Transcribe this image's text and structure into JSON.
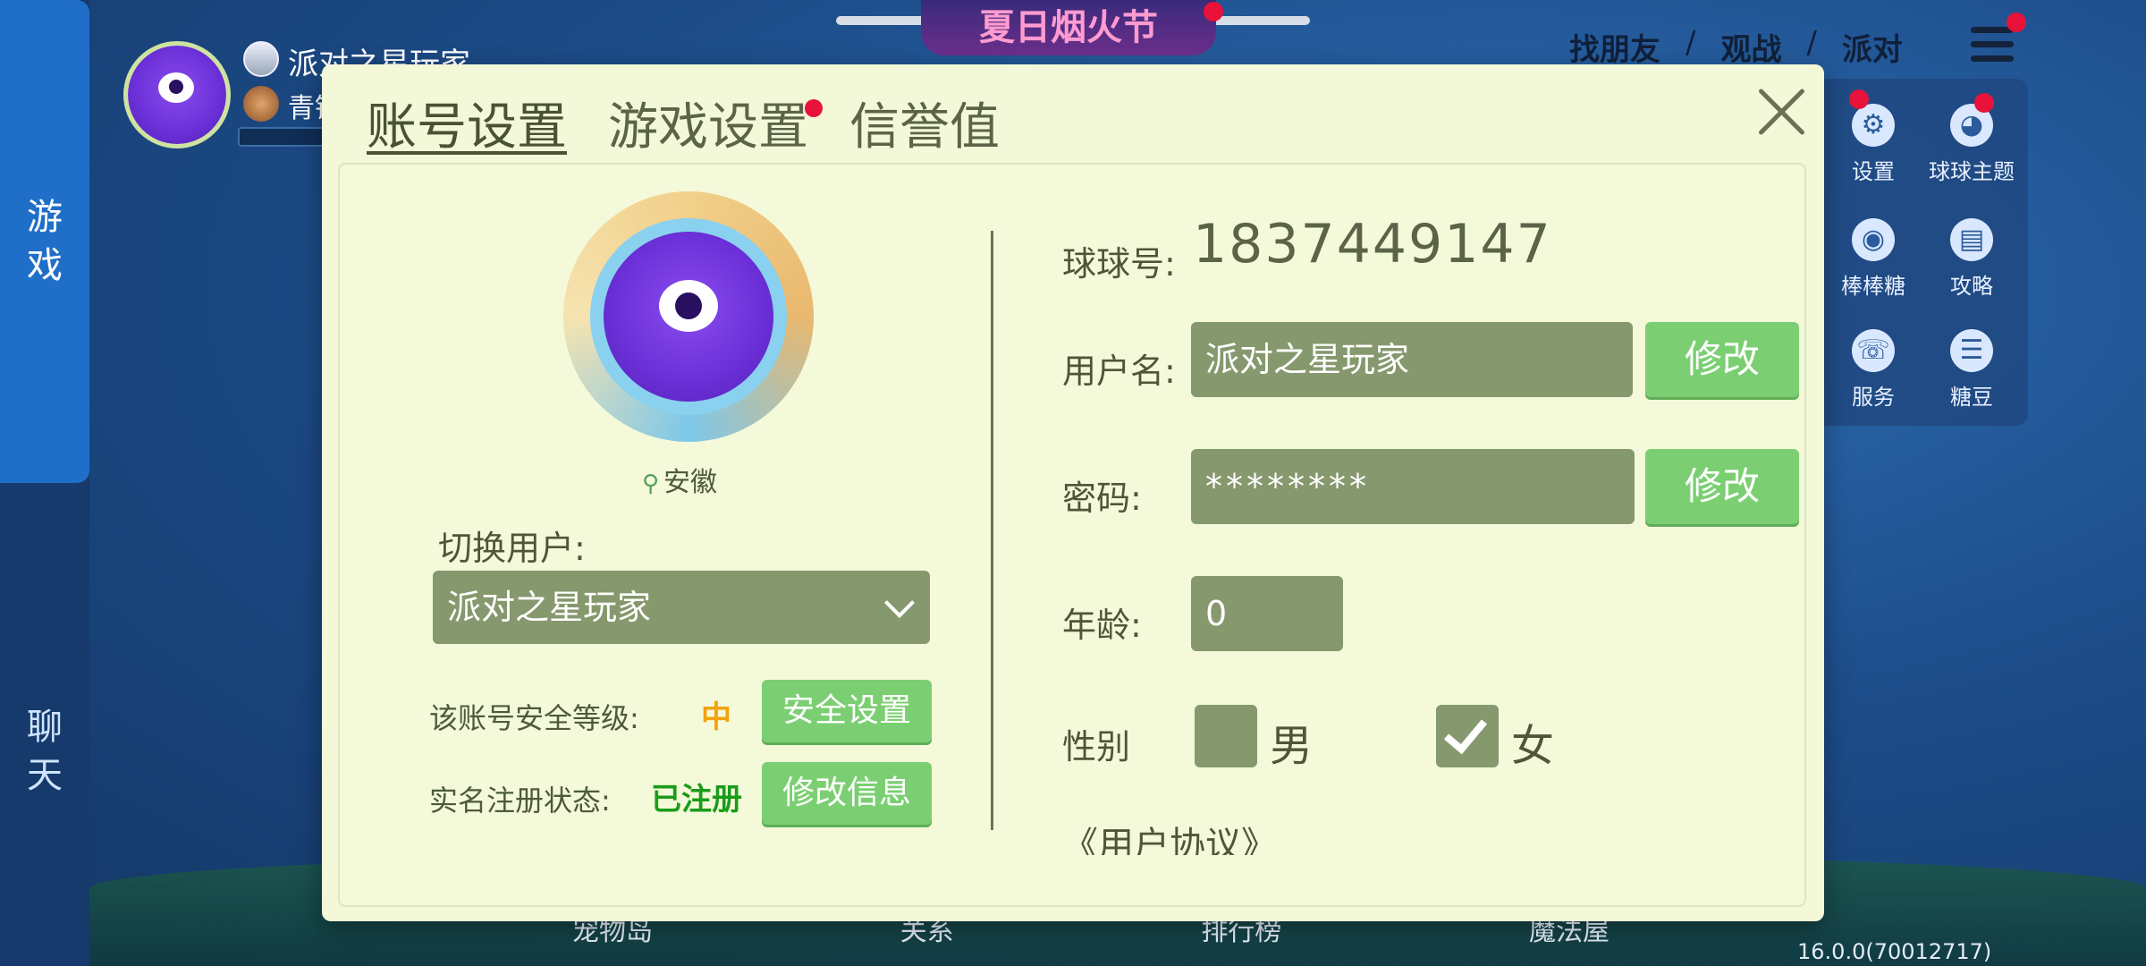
{
  "left_rail": {
    "tabs": [
      {
        "label_line1": "游",
        "label_line2": "戏"
      },
      {
        "label_line1": "聊",
        "label_line2": "天"
      }
    ]
  },
  "player": {
    "name": "派对之星玩家",
    "level_text": "青铜"
  },
  "event_banner": "夏日烟火节",
  "top_nav": {
    "items": [
      "找朋友",
      "观战",
      "派对"
    ],
    "separator": "/"
  },
  "side_panel": {
    "items": [
      {
        "label": "设置",
        "icon": "gear-icon"
      },
      {
        "label": "球球主题",
        "icon": "palette-icon"
      },
      {
        "label": "棒棒糖",
        "icon": "lollipop-icon"
      },
      {
        "label": "攻略",
        "icon": "book-icon"
      },
      {
        "label": "服务",
        "icon": "service-icon"
      },
      {
        "label": "糖豆",
        "icon": "chat-icon"
      }
    ]
  },
  "bottom_nav": [
    "宠物岛",
    "关系",
    "排行榜",
    "魔法屋"
  ],
  "version": "16.0.0(70012717)",
  "dialog": {
    "tabs": [
      {
        "label": "账号设置",
        "active": true
      },
      {
        "label": "游戏设置",
        "active": false,
        "badge": true
      },
      {
        "label": "信誉值",
        "active": false
      }
    ],
    "location": "安徽",
    "switch_user_label": "切换用户:",
    "switch_user_value": "派对之星玩家",
    "security": {
      "label": "该账号安全等级:",
      "level": "中",
      "level_color": "#f2a20c",
      "button": "安全设置"
    },
    "realname": {
      "label": "实名注册状态:",
      "status": "已注册",
      "status_color": "#1a9c1a",
      "button": "修改信息"
    },
    "qq_label": "球球号:",
    "qq_number": "1837449147",
    "username_label": "用户名:",
    "username_value": "派对之星玩家",
    "password_label": "密码:",
    "password_value": "********",
    "edit_button": "修改",
    "age_label": "年龄:",
    "age_value": "0",
    "gender_label": "性别",
    "gender_male": "男",
    "gender_female": "女",
    "gender_selected": "女",
    "agreement_link": "《用户协议》"
  },
  "colors": {
    "dialog_bg": "#f3f8d8",
    "field_bg": "#86986d",
    "button_green": "#7bcf72",
    "badge_red": "#e8123a"
  }
}
